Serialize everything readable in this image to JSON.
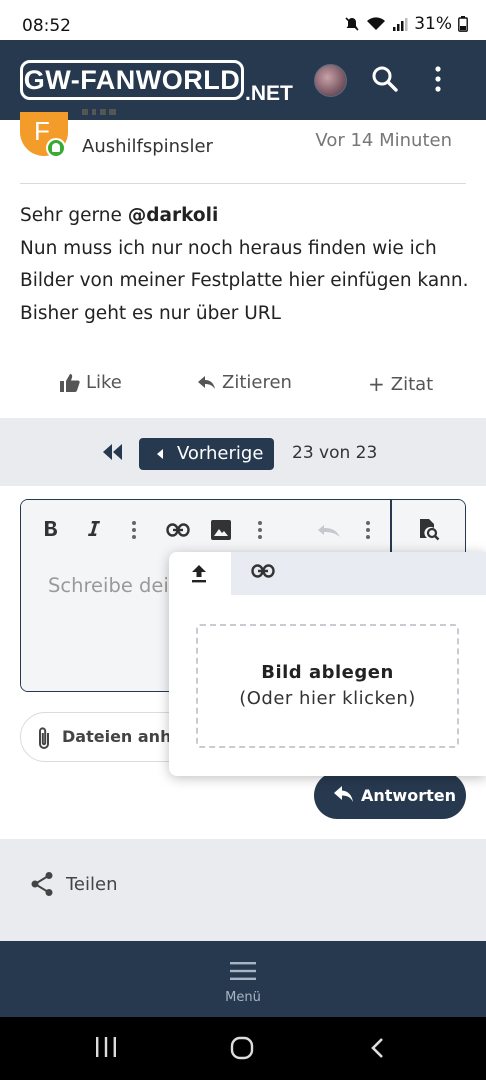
{
  "status_bar": {
    "time": "08:52",
    "battery": "31%"
  },
  "header": {
    "logo_main": "GW-FANWORLD",
    "logo_suffix": ".NET"
  },
  "post": {
    "author_title": "Aushilfspinsler",
    "time": "Vor 14 Minuten",
    "line1_prefix": "Sehr gerne ",
    "mention": "@darkoli",
    "line2": "Nun muss ich nur noch heraus finden wie ich Bilder von meiner Festplatte hier einfügen kann.",
    "line3": "Bisher geht es nur über URL",
    "actions": {
      "like": "Like",
      "quote": "Zitieren",
      "add_quote": "Zitat"
    }
  },
  "pagination": {
    "prev_label": "Vorherige",
    "info": "23 von 23"
  },
  "editor": {
    "placeholder": "Schreibe dei"
  },
  "attach": {
    "label": "Dateien anhä"
  },
  "popup": {
    "drop_title": "Bild ablegen",
    "drop_sub": "(Oder hier klicken)"
  },
  "reply": {
    "label": "Antworten"
  },
  "share": {
    "label": "Teilen"
  },
  "bottom_menu": {
    "label": "Menü"
  }
}
